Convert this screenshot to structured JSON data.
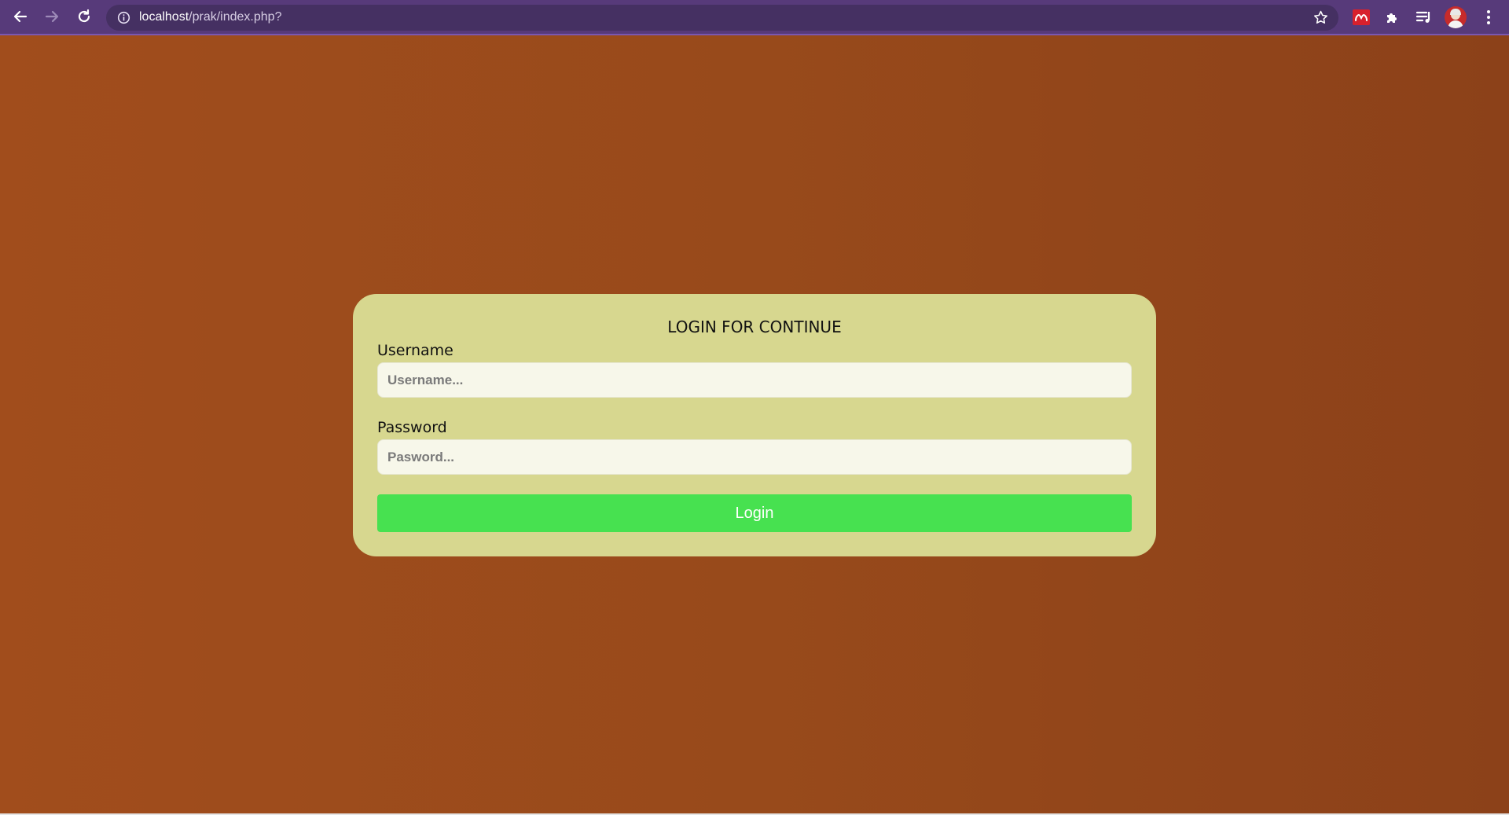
{
  "browser": {
    "url_host": "localhost",
    "url_path": "/prak/index.php?",
    "icons": [
      "back-arrow-icon",
      "forward-arrow-icon",
      "reload-icon",
      "info-icon",
      "star-icon",
      "mendeley-extension-icon",
      "puzzle-extensions-icon",
      "reading-list-icon",
      "avatar",
      "more-menu-icon"
    ]
  },
  "colors": {
    "chrome": "#573a7a",
    "page_background": "#9b4a1c",
    "card": "#d7d78f",
    "button": "#47e150"
  },
  "form": {
    "title": "LOGIN FOR CONTINUE",
    "username_label": "Username",
    "username_placeholder": "Username...",
    "password_label": "Password",
    "password_placeholder": "Pasword...",
    "login_label": "Login"
  }
}
